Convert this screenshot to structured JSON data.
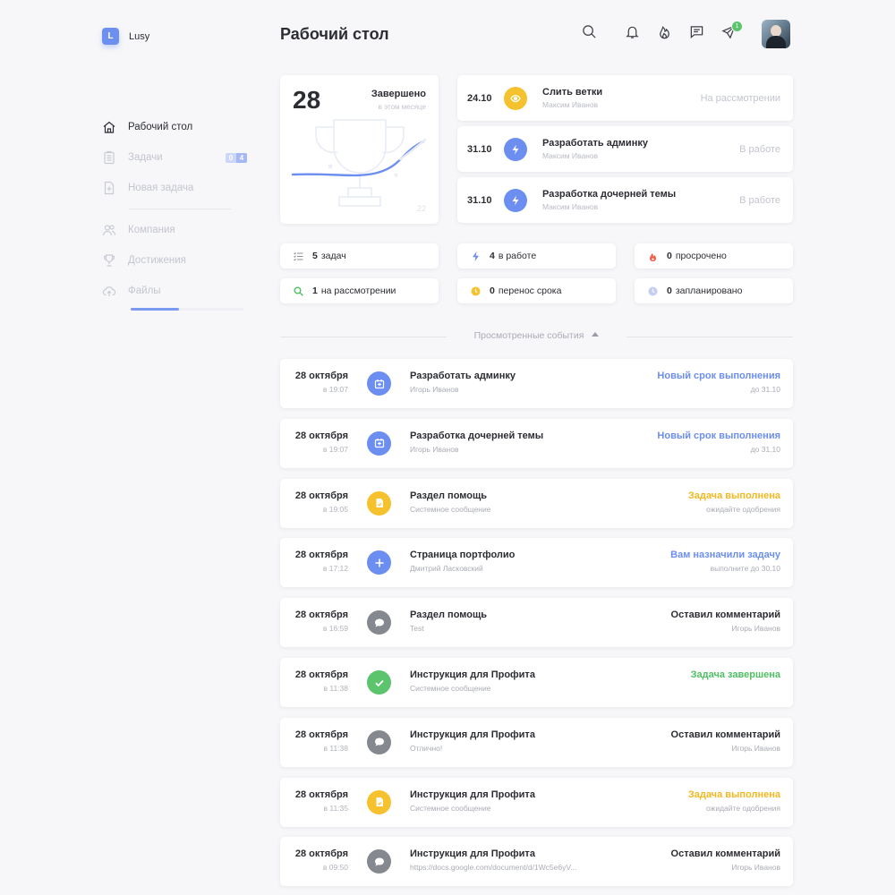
{
  "brand": {
    "logo_letter": "L",
    "name": "Lusy"
  },
  "sidebar": {
    "items": [
      {
        "label": "Рабочий стол",
        "icon": "home-icon"
      },
      {
        "label": "Задачи",
        "icon": "clipboard-list-icon",
        "badge_a": "0",
        "badge_b": "4"
      },
      {
        "label": "Новая задача",
        "icon": "add-file-icon"
      },
      {
        "label": "Компания",
        "icon": "users-icon"
      },
      {
        "label": "Достижения",
        "icon": "trophy-icon"
      },
      {
        "label": "Файлы",
        "icon": "cloud-upload-icon"
      }
    ],
    "files_progress": 0.43
  },
  "header": {
    "title": "Рабочий стол",
    "icons": [
      "search-icon",
      "bell-icon",
      "flame-icon",
      "chat-icon",
      "send-icon"
    ],
    "send_badge": "1"
  },
  "summary": {
    "count": "28",
    "title": "Завершено",
    "subtitle": "в этом месяце",
    "corner_value": "22"
  },
  "upcoming": [
    {
      "date": "24.10",
      "title": "Слить ветки",
      "author": "Максим Иванов",
      "status": "На рассмотрении",
      "icon": "eye-icon",
      "color": "#f5c22e"
    },
    {
      "date": "31.10",
      "title": "Разработать админку",
      "author": "Максим Иванов",
      "status": "В работе",
      "icon": "lightning-icon",
      "color": "#6c8ef0"
    },
    {
      "date": "31.10",
      "title": "Разработка дочерней темы",
      "author": "Максим Иванов",
      "status": "В работе",
      "icon": "lightning-icon",
      "color": "#6c8ef0"
    }
  ],
  "stats": [
    {
      "num": "5",
      "label": "задач",
      "icon": "list-icon"
    },
    {
      "num": "4",
      "label": "в работе",
      "icon": "lightning-icon"
    },
    {
      "num": "0",
      "label": "просрочено",
      "icon": "flame-icon"
    },
    {
      "num": "1",
      "label": "на рассмотрении",
      "icon": "search-icon"
    },
    {
      "num": "0",
      "label": "перенос срока",
      "icon": "clock-icon"
    },
    {
      "num": "0",
      "label": "запланировано",
      "icon": "clock-icon"
    }
  ],
  "events_heading": "Просмотренные события",
  "events": [
    {
      "date": "28 октября",
      "time": "в 19:07",
      "title": "Разработать админку",
      "sub": "Игорь Иванов",
      "action": "Новый срок выполнения",
      "note": "до 31.10",
      "icon": "calendar-icon",
      "icon_color": "#6c8ef0",
      "action_color": "#6c8ef0"
    },
    {
      "date": "28 октября",
      "time": "в 19:07",
      "title": "Разработка дочерней темы",
      "sub": "Игорь Иванов",
      "action": "Новый срок выполнения",
      "note": "до 31.10",
      "icon": "calendar-icon",
      "icon_color": "#6c8ef0",
      "action_color": "#6c8ef0"
    },
    {
      "date": "28 октября",
      "time": "в 19:05",
      "title": "Раздел помощь",
      "sub": "Системное сообщение",
      "action": "Задача выполнена",
      "note": "ожидайте одобрения",
      "icon": "file-check-icon",
      "icon_color": "#f5c22e",
      "action_color": "#f2b822"
    },
    {
      "date": "28 октября",
      "time": "в 17:12",
      "title": "Страница портфолио",
      "sub": "Дмитрий Ласковский",
      "action": "Вам назначили задачу",
      "note": "выполните до 30.10",
      "icon": "plus-icon",
      "icon_color": "#6c8ef0",
      "action_color": "#6c8ef0"
    },
    {
      "date": "28 октября",
      "time": "в 16:59",
      "title": "Раздел помощь",
      "sub": "Test",
      "action": "Оставил комментарий",
      "note": "Игорь Иванов",
      "icon": "comment-icon",
      "icon_color": "#85888f",
      "action_color": "#2b2d33"
    },
    {
      "date": "28 октября",
      "time": "в 11:38",
      "title": "Инструкция для Профита",
      "sub": "Системное сообщение",
      "action": "Задача завершена",
      "note": "",
      "icon": "check-icon",
      "icon_color": "#5cc46c",
      "action_color": "#4fbf62"
    },
    {
      "date": "28 октября",
      "time": "в 11:38",
      "title": "Инструкция для Профита",
      "sub": "Отлично!",
      "action": "Оставил комментарий",
      "note": "Игорь Иванов",
      "icon": "comment-icon",
      "icon_color": "#85888f",
      "action_color": "#2b2d33"
    },
    {
      "date": "28 октября",
      "time": "в 11:35",
      "title": "Инструкция для Профита",
      "sub": "Системное сообщение",
      "action": "Задача выполнена",
      "note": "ожидайте одобрения",
      "icon": "file-check-icon",
      "icon_color": "#f5c22e",
      "action_color": "#f2b822"
    },
    {
      "date": "28 октября",
      "time": "в 09:50",
      "title": "Инструкция для Профита",
      "sub": "https://docs.google.com/document/d/1Wc5e6yV...",
      "action": "Оставил комментарий",
      "note": "Игорь Иванов",
      "icon": "comment-icon",
      "icon_color": "#85888f",
      "action_color": "#2b2d33"
    }
  ]
}
